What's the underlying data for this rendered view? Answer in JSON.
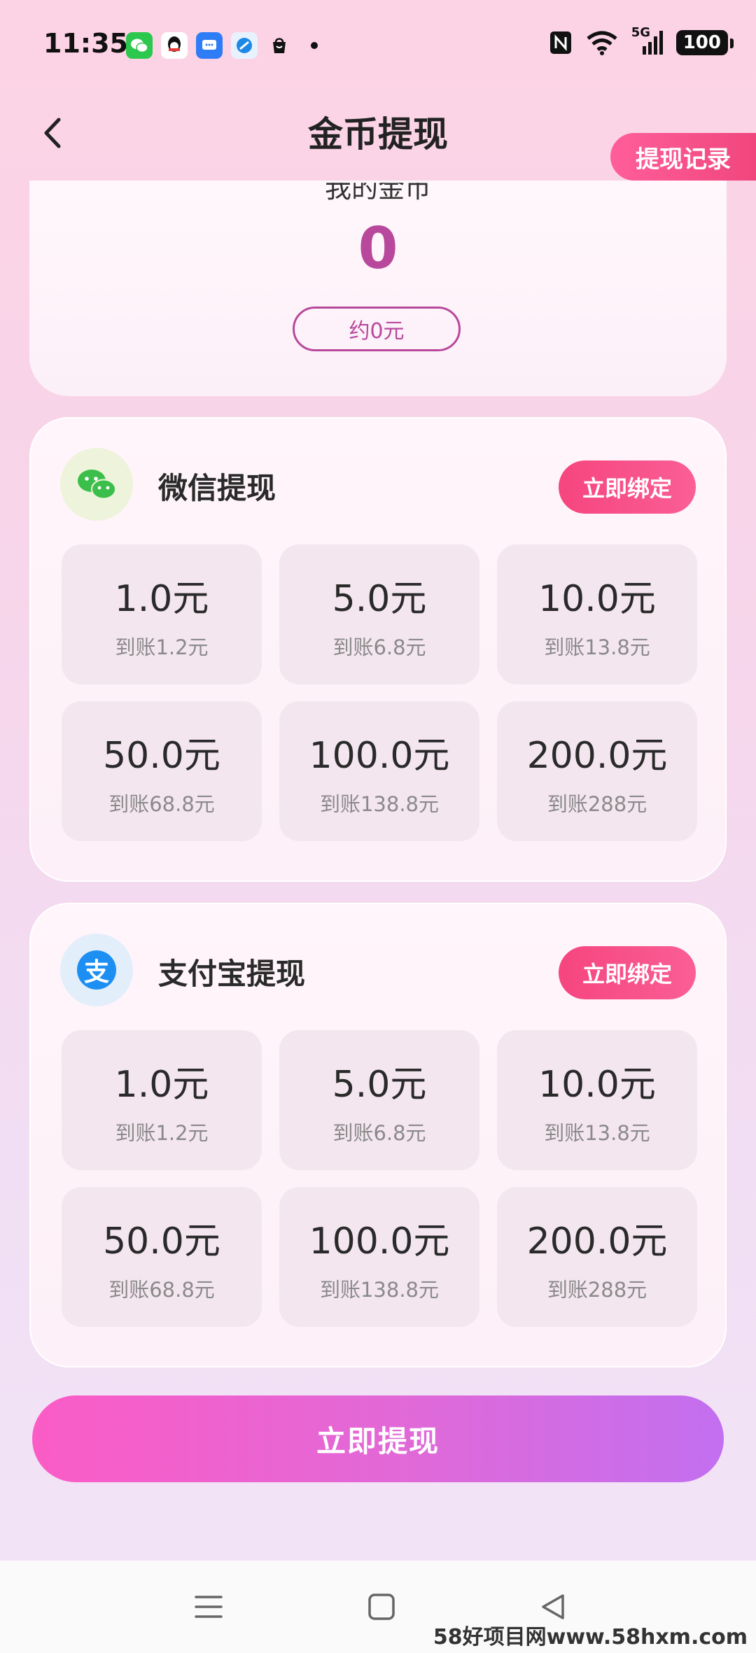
{
  "status_bar": {
    "time": "11:35",
    "network": "5G",
    "battery": "100",
    "app_icons": [
      "wechat-icon",
      "qq-icon",
      "message-icon",
      "browser-icon",
      "shopping-bag-icon"
    ]
  },
  "header": {
    "title": "金币提现",
    "record_button": "提现记录"
  },
  "coins": {
    "label": "我的金币",
    "value": "0",
    "approx": "约0元"
  },
  "methods": [
    {
      "name": "微信提现",
      "icon": "wechat-icon",
      "bind_label": "立即绑定",
      "options": [
        {
          "amount": "1.0元",
          "receive": "到账1.2元"
        },
        {
          "amount": "5.0元",
          "receive": "到账6.8元"
        },
        {
          "amount": "10.0元",
          "receive": "到账13.8元"
        },
        {
          "amount": "50.0元",
          "receive": "到账68.8元"
        },
        {
          "amount": "100.0元",
          "receive": "到账138.8元"
        },
        {
          "amount": "200.0元",
          "receive": "到账288元"
        }
      ]
    },
    {
      "name": "支付宝提现",
      "icon": "alipay-icon",
      "icon_text": "支",
      "bind_label": "立即绑定",
      "options": [
        {
          "amount": "1.0元",
          "receive": "到账1.2元"
        },
        {
          "amount": "5.0元",
          "receive": "到账6.8元"
        },
        {
          "amount": "10.0元",
          "receive": "到账13.8元"
        },
        {
          "amount": "50.0元",
          "receive": "到账68.8元"
        },
        {
          "amount": "100.0元",
          "receive": "到账138.8元"
        },
        {
          "amount": "200.0元",
          "receive": "到账288元"
        }
      ]
    }
  ],
  "withdraw_button": "立即提现",
  "watermark": "58好项目网www.58hxm.com",
  "colors": {
    "accent": "#b8489c",
    "bind": "#f6457f",
    "withdraw_start": "#fb5cc6",
    "withdraw_end": "#c26ff0"
  }
}
